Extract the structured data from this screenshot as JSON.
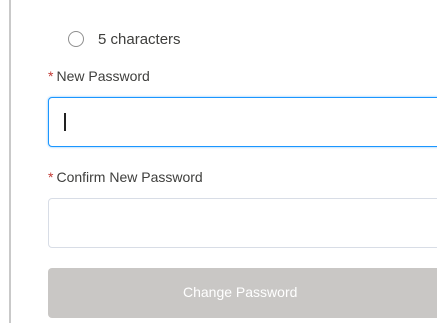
{
  "requirements": {
    "items": [
      {
        "text": "5 characters"
      }
    ]
  },
  "form": {
    "required_marker": "*",
    "new_password": {
      "label": "New Password",
      "value": ""
    },
    "confirm_password": {
      "label": "Confirm New Password",
      "value": ""
    },
    "submit_label": "Change Password"
  },
  "colors": {
    "required_marker": "#c23934",
    "focus_border": "#1b96ff",
    "disabled_button": "#c9c7c5"
  }
}
